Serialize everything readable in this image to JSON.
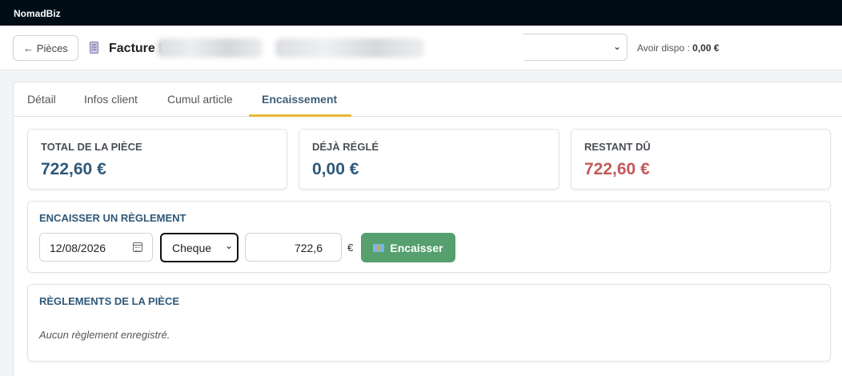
{
  "app": {
    "name": "NomadBiz"
  },
  "header": {
    "back_label": "← Pièces",
    "doc_title": "Facture F",
    "avoir_label": "Avoir dispo :",
    "avoir_value": "0,00 €"
  },
  "tabs": [
    {
      "label": "Détail"
    },
    {
      "label": "Infos client"
    },
    {
      "label": "Cumul article"
    },
    {
      "label": "Encaissement",
      "active": true
    }
  ],
  "summary": {
    "total": {
      "label": "TOTAL DE LA PIÈCE",
      "value": "722,60 €"
    },
    "deja_regle": {
      "label": "DÉJÀ RÉGLÉ",
      "value": "0,00 €"
    },
    "restant": {
      "label": "RESTANT DÛ",
      "value": "722,60 €"
    }
  },
  "encaisser": {
    "title": "ENCAISSER UN RÈGLEMENT",
    "date": "12/08/2026",
    "mode": "Cheque",
    "amount": "722,6",
    "currency": "€",
    "button_label": "Encaisser"
  },
  "reglements": {
    "title": "RÈGLEMENTS DE LA PIÈCE",
    "empty_message": "Aucun règlement enregistré."
  },
  "colors": {
    "titlebar": "#000c16",
    "accent_blue": "#2f5878",
    "due_red": "#c25a5a",
    "tab_underline": "#e6b73a",
    "button_green": "#55a06e"
  }
}
